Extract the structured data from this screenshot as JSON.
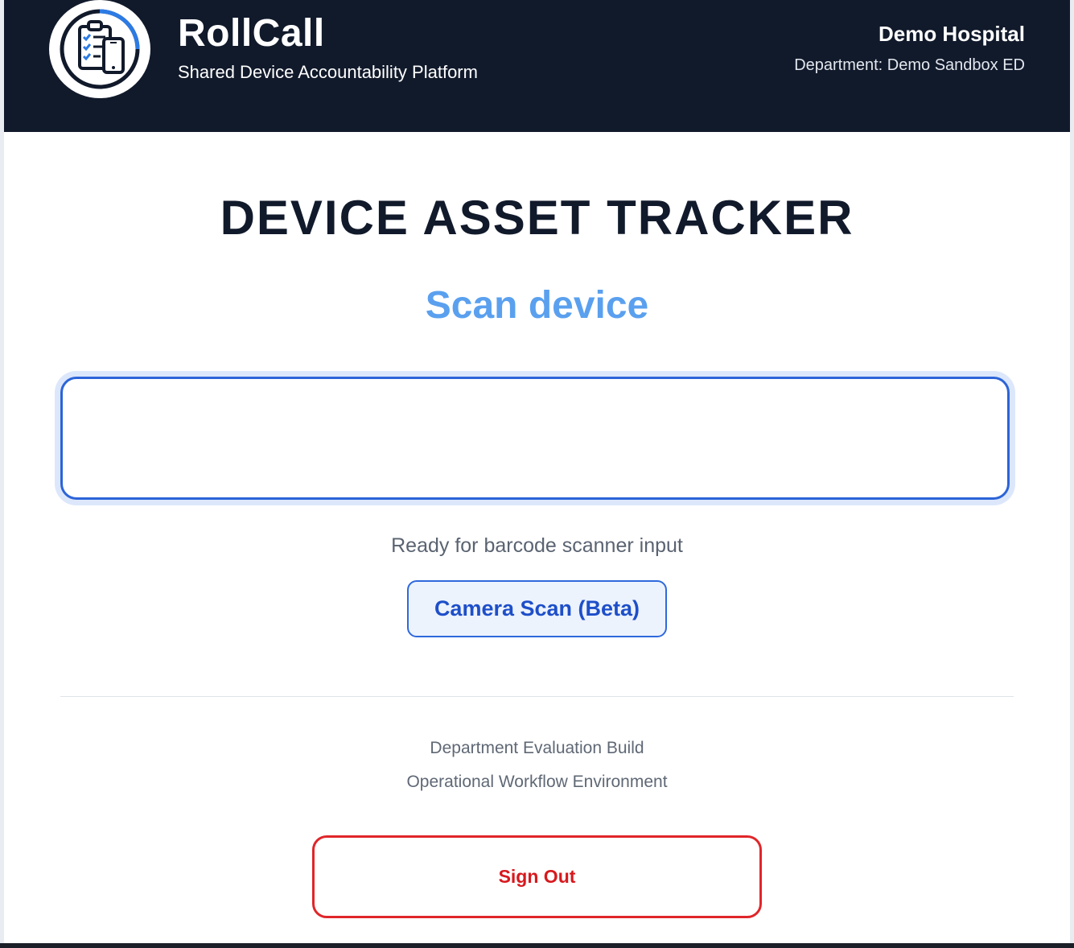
{
  "header": {
    "app_name": "RollCall",
    "app_subtitle": "Shared Device Accountability Platform",
    "organization": "Demo Hospital",
    "department": "Department: Demo Sandbox ED",
    "logo_icon": "clipboard-phone-icon"
  },
  "main": {
    "page_title": "DEVICE ASSET TRACKER",
    "section_title": "Scan device",
    "scan_input": {
      "value": "",
      "placeholder": ""
    },
    "scanner_status": "Ready for barcode scanner input",
    "camera_button_label": "Camera Scan (Beta)"
  },
  "footer": {
    "build_label": "Department Evaluation Build",
    "environment_label": "Operational Workflow Environment",
    "sign_out_label": "Sign Out"
  },
  "colors": {
    "header_background": "#111a2b",
    "accent_blue": "#2c64d8",
    "section_title_blue": "#5aa0ef",
    "danger_red": "#e0262a",
    "page_title": "#111a2b"
  }
}
